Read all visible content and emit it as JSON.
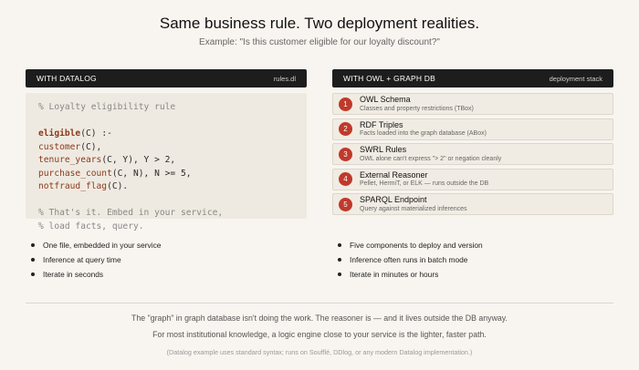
{
  "title": "Same business rule. Two deployment realities.",
  "subtitle": "Example: \"Is this customer eligible for our loyalty discount?\"",
  "left": {
    "header": "WITH DATALOG",
    "tag": "rules.dl",
    "code": {
      "comment1": "% Loyalty eligibility rule",
      "head": "eligible",
      "head_rest": "(C) :-",
      "l1_pred": "customer",
      "l1_rest": "(C),",
      "l2_pred": "tenure_years",
      "l2_rest": "(C, Y), Y > 2,",
      "l3_pred": "purchase_count",
      "l3_rest": "(C, N), N >= 5,",
      "l4_pred": "notfraud_flag",
      "l4_rest": "(C).",
      "comment2": "% That's it. Embed in your service,",
      "comment3": "% load facts, query."
    },
    "bullets": [
      "One file, embedded in your service",
      "Inference at query time",
      "Iterate in seconds"
    ]
  },
  "right": {
    "header": "WITH OWL + GRAPH DB",
    "tag": "deployment stack",
    "steps": [
      {
        "num": "1",
        "title": "OWL Schema",
        "desc": "Classes and property restrictions (TBox)"
      },
      {
        "num": "2",
        "title": "RDF Triples",
        "desc": "Facts loaded into the graph database (ABox)"
      },
      {
        "num": "3",
        "title": "SWRL Rules",
        "desc": "OWL alone can't express \"> 2\" or negation cleanly"
      },
      {
        "num": "4",
        "title": "External Reasoner",
        "desc": "Pellet, HermiT, or ELK — runs outside the DB"
      },
      {
        "num": "5",
        "title": "SPARQL Endpoint",
        "desc": "Query against materialized inferences"
      }
    ],
    "bullets": [
      "Five components to deploy and version",
      "Inference often runs in batch mode",
      "Iterate in minutes or hours"
    ]
  },
  "footer": {
    "line1": "The \"graph\" in graph database isn't doing the work. The reasoner is — and it lives outside the DB anyway.",
    "line2": "For most institutional knowledge, a logic engine close to your service is the lighter, faster path.",
    "note": "(Datalog example uses standard syntax; runs on Soufflé, DDlog, or any modern Datalog implementation.)"
  },
  "colors": {
    "step_badge": "#c0392b",
    "header_bg": "#1d1d1d",
    "predicate": "#8a3a1c"
  }
}
